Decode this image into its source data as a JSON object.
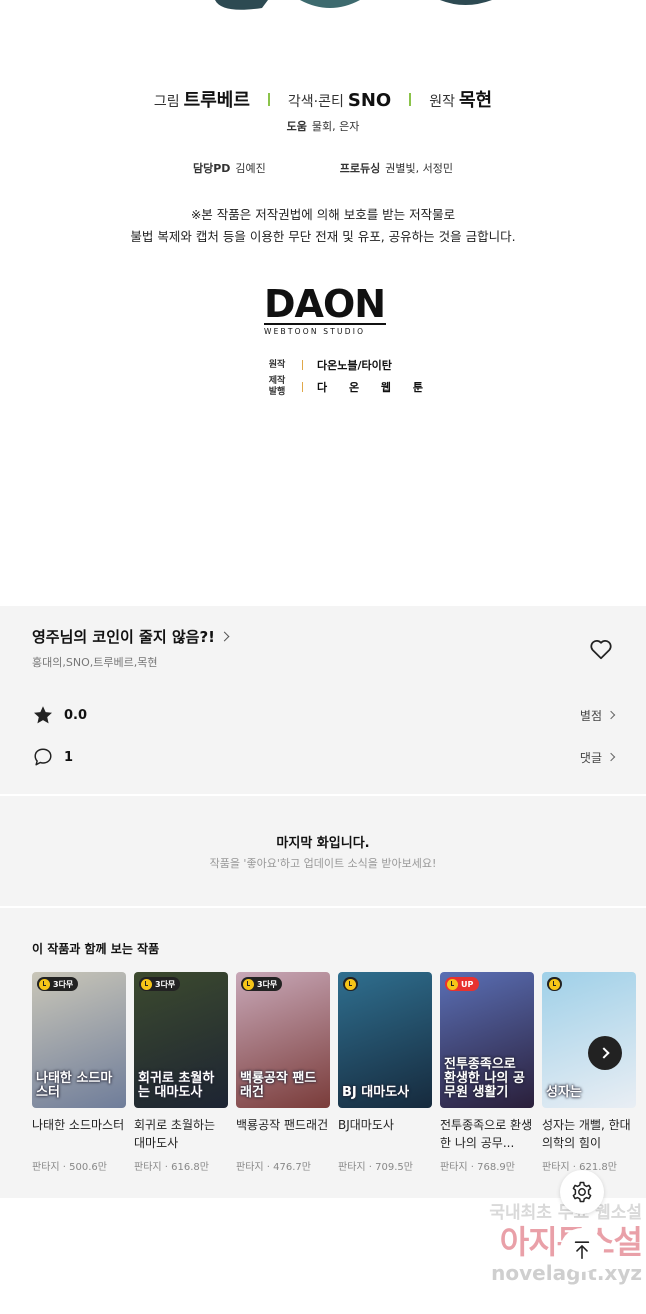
{
  "credits": {
    "art_label": "그림",
    "art_name": "트루베르",
    "color_label": "각색·콘티",
    "color_name": "SNO",
    "original_label": "원작",
    "original_name": "목현",
    "assist_label": "도움",
    "assist_names": "물회, 은자",
    "pd_label": "담당PD",
    "pd_name": "김예진",
    "producing_label": "프로듀싱",
    "producing_names": "권별빛, 서정민",
    "copyright_line1": "※본 작품은 저작권법에 의해 보호를 받는 저작물로",
    "copyright_line2": "불법 복제와 캡처 등을 이용한 무단 전재 및 유포, 공유하는 것을 금합니다."
  },
  "studio": {
    "logo_text": "DAON",
    "logo_sub": "WEBTOON STUDIO",
    "original_label": "원작",
    "original_value": "다온노블/타이탄",
    "production_label_1": "제작",
    "production_label_2": "발행",
    "production_value": "다 온 웹 툰"
  },
  "work": {
    "title": "영주님의 코인이 줄지 않음?!",
    "authors": "홍대의,SNO,트루베르,목현",
    "rating": "0.0",
    "rating_link": "별점",
    "comments": "1",
    "comments_link": "댓글"
  },
  "last_episode": {
    "title": "마지막 화입니다.",
    "subtitle": "작품을 '좋아요'하고 업데이트 소식을 받아보세요!"
  },
  "recommend": {
    "heading": "이 작품과 함께 보는 작품",
    "cards": [
      {
        "badge": "3다무",
        "thumb_title": "나태한 소드마스터",
        "name": "나태한 소드마스터",
        "meta": "판타지 · 500.6만",
        "bg1": "#c9c6b8",
        "bg2": "#6f7d9a"
      },
      {
        "badge": "3다무",
        "thumb_title": "회귀로 초월하는 대마도사",
        "name": "회귀로 초월하는 대마도사",
        "meta": "판타지 · 616.8만",
        "bg1": "#3c4a2e",
        "bg2": "#1d2433"
      },
      {
        "badge": "3다무",
        "thumb_title": "백룡공작 팬드래건",
        "name": "백룡공작 팬드래건",
        "meta": "판타지 · 476.7만",
        "bg1": "#c8a8b8",
        "bg2": "#7a3c3a"
      },
      {
        "badge": "",
        "thumb_title": "BJ 대마도사",
        "name": "BJ대마도사",
        "meta": "판타지 · 709.5만",
        "bg1": "#2f6f8f",
        "bg2": "#162a3d"
      },
      {
        "badge": "UP",
        "thumb_title": "전투종족으로 환생한 나의 공무원 생활기",
        "name": "전투종족으로 환생한 나의 공무...",
        "meta": "판타지 · 768.9만",
        "bg1": "#5a6fb5",
        "bg2": "#2a1f3a"
      },
      {
        "badge": "",
        "thumb_title": "성자는",
        "name": "성자는 개뻘, 한대의학의 힘이",
        "meta": "판타지 · 621.8만",
        "bg1": "#9fd0e8",
        "bg2": "#e9eef4"
      }
    ]
  },
  "watermark": {
    "line1": "국내최초 무료 웹소설",
    "line2": "아지툰소설",
    "line3": "novelagit.xyz"
  },
  "colors": {
    "accent_green": "#8bc34a",
    "panel_bg": "#f4f4f4",
    "up_red": "#e8322f",
    "badge_yellow": "#f5c518"
  }
}
